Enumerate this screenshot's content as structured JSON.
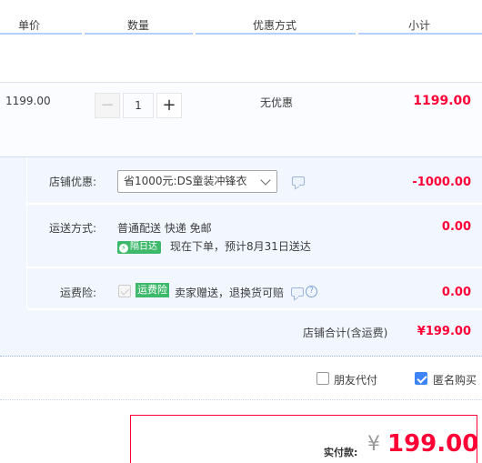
{
  "header": {
    "col_price": "单价",
    "col_qty": "数量",
    "col_promo": "优惠方式",
    "col_subtotal": "小计"
  },
  "item": {
    "price": "1199.00",
    "quantity": "1",
    "qty_minus": "−",
    "qty_plus": "+",
    "promo": "无优惠",
    "subtotal": "1199.00"
  },
  "order": {
    "shop_discount_label": "店铺优惠:",
    "shop_discount_selected": "省1000元:DS童装冲锋衣",
    "shop_discount_amount": "-1000.00",
    "shipping_label": "运送方式:",
    "shipping_method": "普通配送 快递 免邮",
    "sameday_badge": "隔日达",
    "sameday_icon": "⚡",
    "delivery_note": "现在下单，预计8月31日送达",
    "shipping_amount": "0.00",
    "insurance_label": "运费险:",
    "insurance_badge": "运费险",
    "insurance_text": "卖家赠送，退换货可赔",
    "insurance_help": "?",
    "insurance_amount": "0.00",
    "total_label": "店铺合计(含运费)",
    "total_amount": "¥199.00"
  },
  "options": {
    "friend_pay": "朋友代付",
    "anonymous": "匿名购买"
  },
  "pay": {
    "label": "实付款:",
    "currency": "¥",
    "amount": "199.00"
  },
  "colors": {
    "accent_red": "#ff0036",
    "header_line": "#b2d1ff",
    "section_bg": "#f2f7ff",
    "badge_green": "#3eb96b",
    "checkbox_blue": "#3d85f7"
  }
}
